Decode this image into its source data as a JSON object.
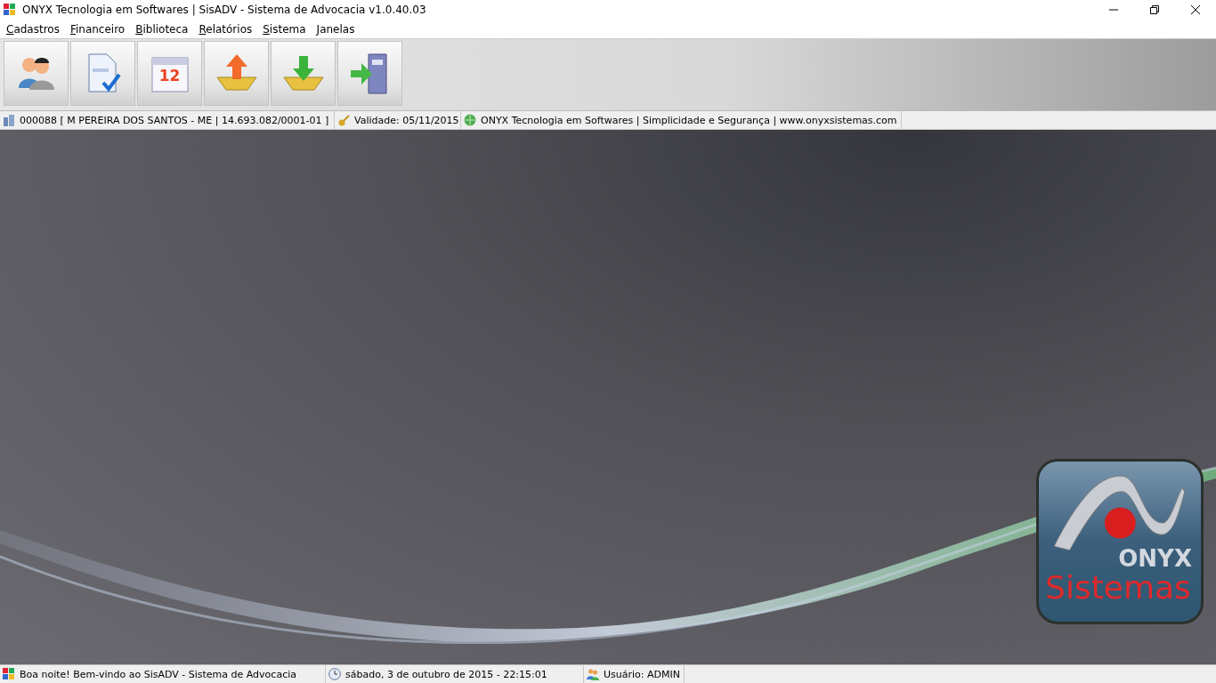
{
  "window": {
    "title": "ONYX Tecnologia em Softwares | SisADV - Sistema de Advocacia v1.0.40.03"
  },
  "menu": [
    "Cadastros",
    "Financeiro",
    "Biblioteca",
    "Relatórios",
    "Sistema",
    "Janelas"
  ],
  "toolbar": [
    {
      "kind": "people"
    },
    {
      "kind": "document"
    },
    {
      "kind": "calendar",
      "text": "12"
    },
    {
      "kind": "upload"
    },
    {
      "kind": "download"
    },
    {
      "kind": "exit"
    }
  ],
  "info_bar": [
    {
      "kind": "company",
      "text": "000088 [ M PEREIRA DOS SANTOS - ME | 14.693.082/0001-01 ]"
    },
    {
      "kind": "key",
      "text": "Validade: 05/11/2015"
    },
    {
      "kind": "globe",
      "text": "ONYX Tecnologia em Softwares | Simplicidade e Segurança | www.onyxsistemas.com"
    }
  ],
  "logo": {
    "line1": "ONYX",
    "line2": "Sistemas"
  },
  "status_bar": [
    {
      "kind": "app",
      "text": "Boa noite! Bem-vindo ao SisADV - Sistema de Advocacia"
    },
    {
      "kind": "clock",
      "text": "sábado, 3 de outubro de 2015 - 22:15:01"
    },
    {
      "kind": "users",
      "text": "Usuário: ADMIN"
    }
  ]
}
